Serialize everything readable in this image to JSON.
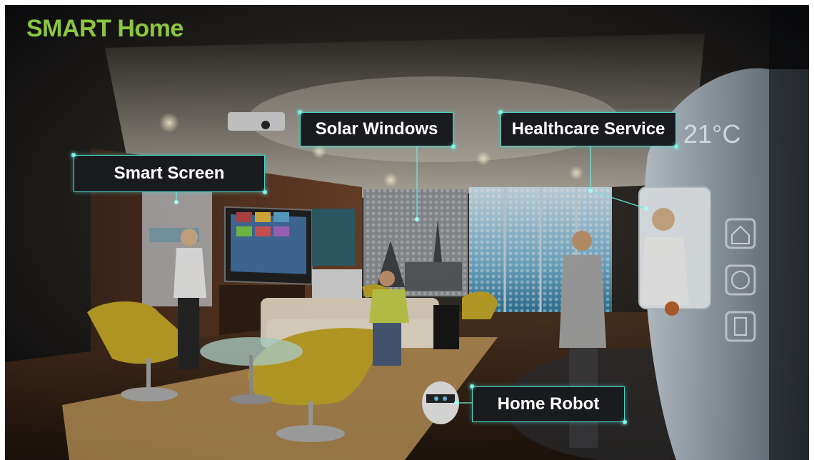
{
  "title": "SMART Home",
  "labels": {
    "smart_screen": "Smart Screen",
    "solar_windows": "Solar Windows",
    "healthcare_service": "Healthcare Service",
    "home_robot": "Home Robot"
  },
  "wall_display": {
    "temperature": "21°C"
  },
  "colors": {
    "title": "#8cc63f",
    "label_border": "#4fd1c5",
    "label_bg": "#1a1b1e"
  }
}
